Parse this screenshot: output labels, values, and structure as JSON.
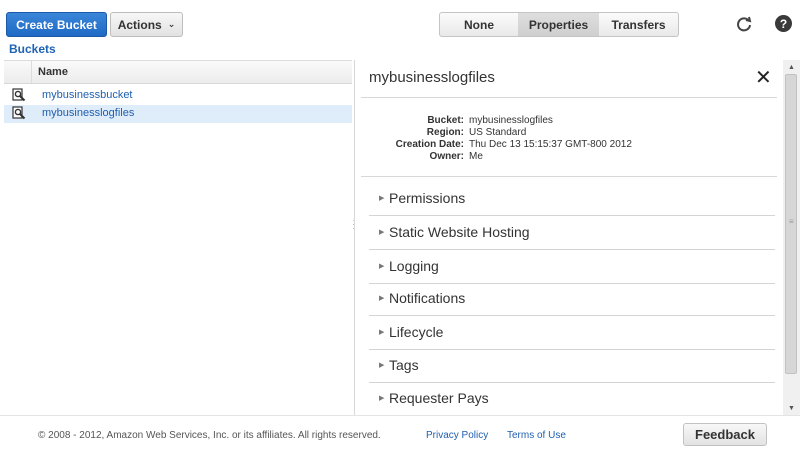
{
  "toolbar": {
    "create_bucket_label": "Create Bucket",
    "actions_label": "Actions",
    "view_buttons": [
      "None",
      "Properties",
      "Transfers"
    ],
    "selected_view": "Properties",
    "refresh_icon": "refresh-icon",
    "help_icon": "help-icon",
    "help_glyph": "?"
  },
  "left": {
    "title": "Buckets",
    "column_header": "Name",
    "rows": [
      {
        "name": "mybusinessbucket",
        "icon": "magnifier-icon",
        "selected": false
      },
      {
        "name": "mybusinesslogfiles",
        "icon": "magnifier-icon",
        "selected": true
      }
    ]
  },
  "properties": {
    "title": "mybusinesslogfiles",
    "meta": [
      {
        "key": "Bucket:",
        "value": "mybusinesslogfiles"
      },
      {
        "key": "Region:",
        "value": "US Standard"
      },
      {
        "key": "Creation Date:",
        "value": "Thu Dec 13 15:15:37 GMT-800 2012"
      },
      {
        "key": "Owner:",
        "value": "Me"
      }
    ],
    "sections": [
      "Permissions",
      "Static Website Hosting",
      "Logging",
      "Notifications",
      "Lifecycle",
      "Tags",
      "Requester Pays"
    ]
  },
  "footer": {
    "copyright": "© 2008 - 2012, Amazon Web Services, Inc. or its affiliates. All rights reserved.",
    "privacy_label": "Privacy Policy",
    "terms_label": "Terms of Use",
    "feedback_label": "Feedback"
  },
  "colors": {
    "primary_button": "#1f6ac4",
    "link": "#1f5fb0",
    "selected_row": "#dfecf9"
  }
}
